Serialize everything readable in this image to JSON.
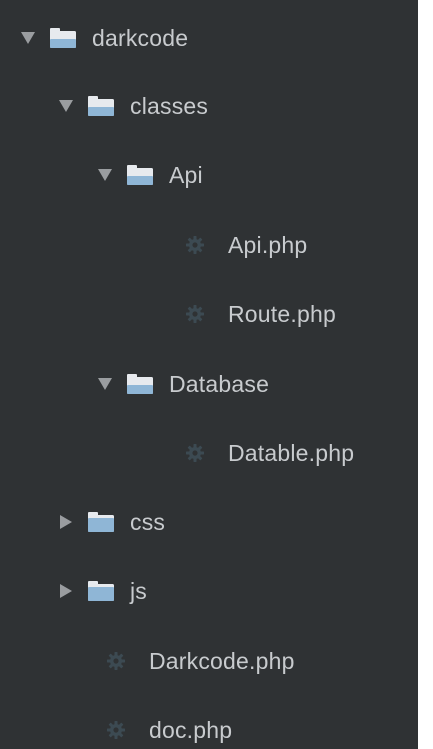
{
  "tree": {
    "root": {
      "label": "darkcode",
      "expanded": true,
      "icon": "folder-open-icon"
    },
    "classes": {
      "label": "classes",
      "expanded": true,
      "icon": "folder-open-icon"
    },
    "api_folder": {
      "label": "Api",
      "expanded": true,
      "icon": "folder-open-icon"
    },
    "api_php": {
      "label": "Api.php",
      "icon": "gear-icon"
    },
    "route_php": {
      "label": "Route.php",
      "icon": "gear-icon"
    },
    "database_folder": {
      "label": "Database",
      "expanded": true,
      "icon": "folder-open-icon"
    },
    "datable_php": {
      "label": "Datable.php",
      "icon": "gear-icon"
    },
    "css_folder": {
      "label": "css",
      "expanded": false,
      "icon": "folder-closed-icon"
    },
    "js_folder": {
      "label": "js",
      "expanded": false,
      "icon": "folder-closed-icon"
    },
    "darkcode_php": {
      "label": "Darkcode.php",
      "icon": "gear-icon"
    },
    "doc_php": {
      "label": "doc.php",
      "icon": "gear-icon"
    }
  },
  "colors": {
    "panel_bg": "#2f3234",
    "text": "#c8cbce",
    "arrow": "#9a9da0",
    "folder_top": "#e7eaee",
    "folder_body": "#8fb6d6",
    "file_icon": "#3c4a52"
  }
}
